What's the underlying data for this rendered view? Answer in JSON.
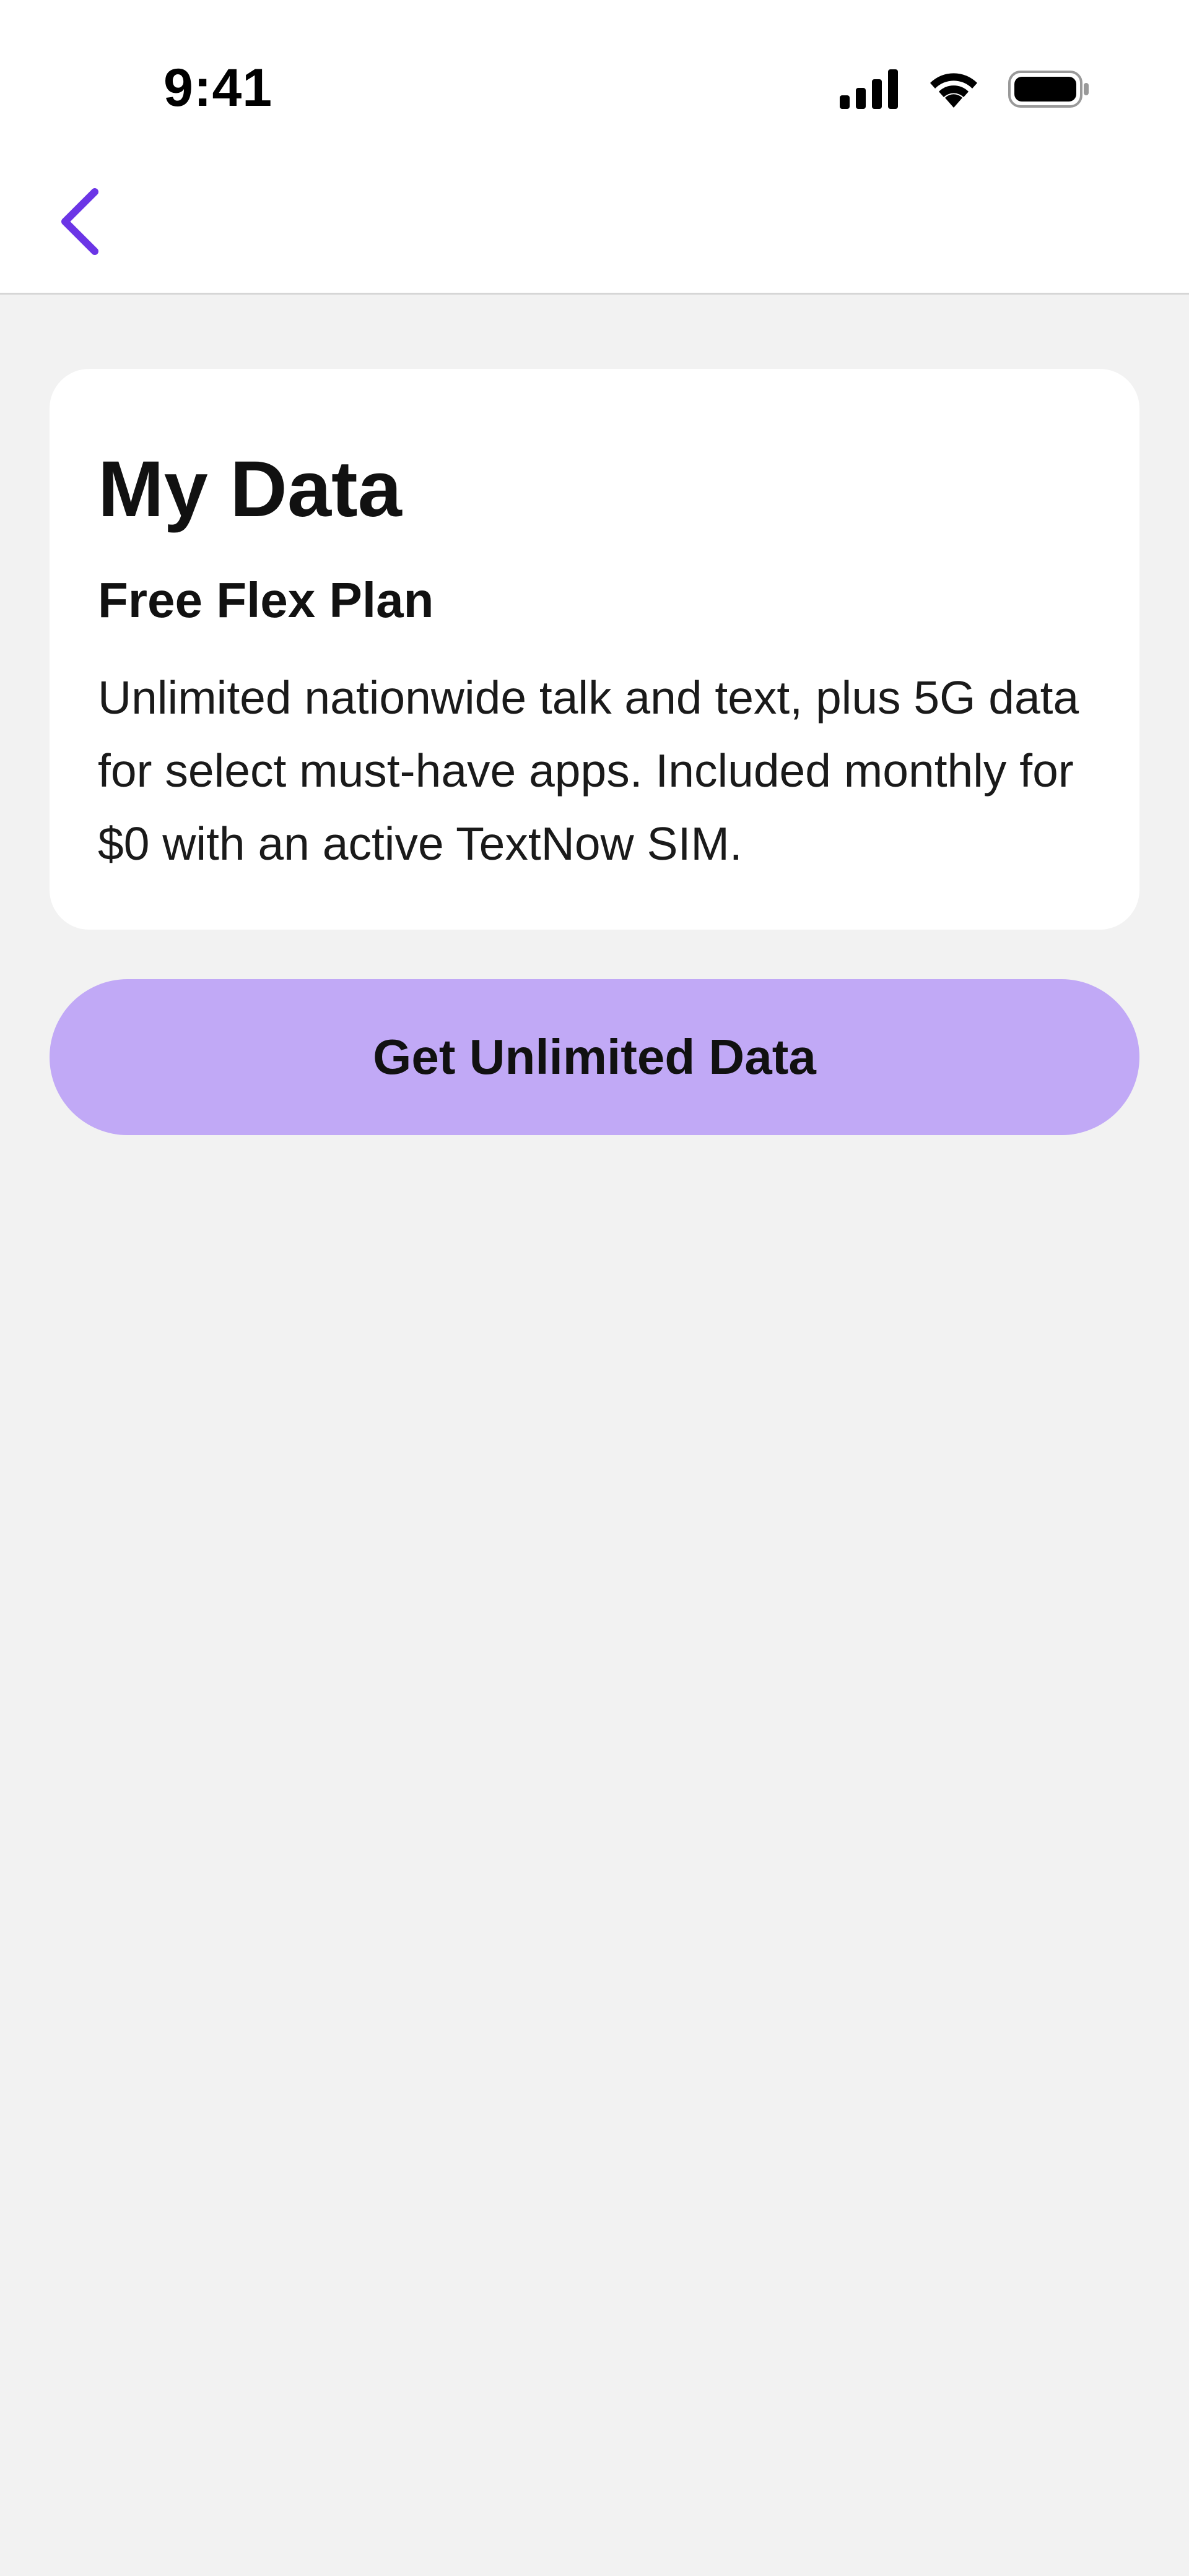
{
  "status_bar": {
    "time": "9:41",
    "icons": [
      "cellular-signal-icon",
      "wifi-icon",
      "battery-icon"
    ]
  },
  "nav": {
    "back_icon": "chevron-left-icon",
    "accent_color": "#6b35e6"
  },
  "card": {
    "title": "My Data",
    "plan_name": "Free Flex Plan",
    "description": "Unlimited nationwide talk and text, plus 5G data for select must-have apps. Included monthly for $0 with an active TextNow SIM."
  },
  "cta": {
    "label": "Get Unlimited Data",
    "color": "#c1a9f6"
  }
}
